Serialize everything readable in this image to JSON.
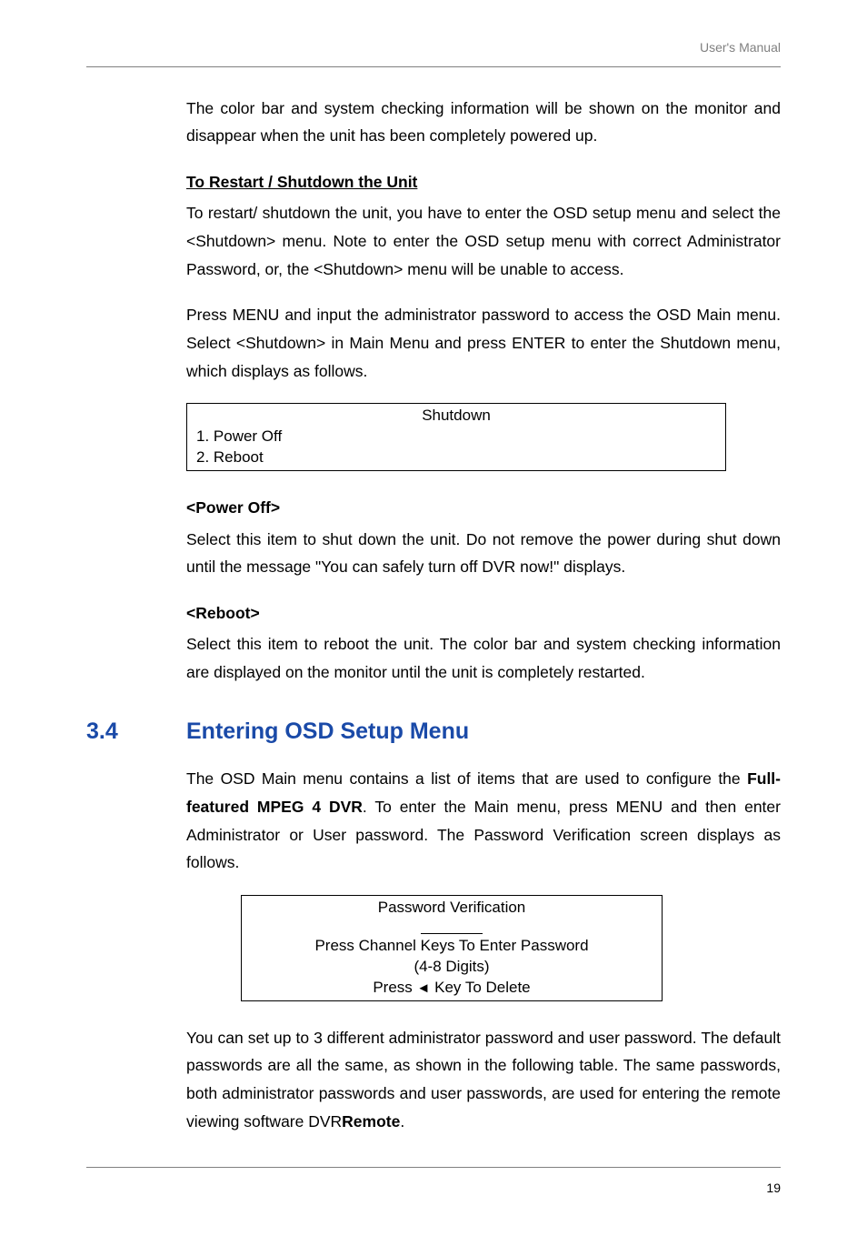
{
  "header": {
    "manual_label": "User's Manual"
  },
  "para1": "The color bar and system checking information will be shown on the monitor and disappear when the unit has been completely powered up.",
  "restart_heading": "To Restart / Shutdown the Unit",
  "para2": "To restart/ shutdown the unit, you have to enter the OSD setup menu and select the <Shutdown> menu. Note to enter the OSD setup menu with correct Administrator Password, or, the <Shutdown> menu will be unable to access.",
  "para3": "Press MENU and input the administrator password to access the OSD Main menu. Select <Shutdown> in Main Menu and press ENTER to enter the Shutdown menu, which displays as follows.",
  "shutdown_box": {
    "title": "Shutdown",
    "item1": "1. Power Off",
    "item2": "2. Reboot"
  },
  "poweroff_heading": "<Power Off>",
  "para4": "Select this item to shut down the unit. Do not remove the power during shut down until the message \"You can safely turn off DVR now!\" displays.",
  "reboot_heading": "<Reboot>",
  "para5": "Select this item to reboot the unit. The color bar and system checking information are displayed on the monitor until the unit is completely restarted.",
  "section": {
    "num": "3.4",
    "title": "Entering OSD Setup Menu"
  },
  "para6_a": "The OSD Main menu contains a list of items that are used to configure the ",
  "para6_bold": "Full-featured MPEG 4 DVR",
  "para6_b": ". To enter the Main menu, press MENU and then enter Administrator or User password. The Password Verification screen displays as follows.",
  "verif_box": {
    "title": "Password Verification",
    "line1": "Press Channel Keys To Enter Password",
    "line2": "(4-8 Digits)",
    "line3a": "Press ",
    "line3b": " Key To Delete"
  },
  "para7_a": "You can set up to 3 different administrator password and user password. The default passwords are all the same, as shown in the following table. The same passwords, both administrator passwords and user passwords, are used for entering the remote viewing software DVR",
  "para7_bold": "Remote",
  "para7_b": ".",
  "footer": {
    "page": "19"
  }
}
